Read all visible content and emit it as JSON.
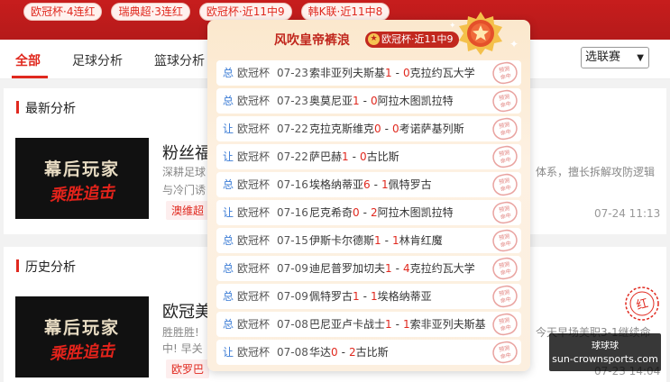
{
  "top_tags": [
    "欧冠杯·4连红",
    "瑞典超·3连红",
    "欧冠杯·近11中9",
    "韩K联·近11中8"
  ],
  "tabs": [
    "全部",
    "足球分析",
    "篮球分析"
  ],
  "league_select": {
    "value": "选联赛"
  },
  "sections": {
    "latest": {
      "title": "最新分析",
      "thumb_line1": "幕后玩家",
      "thumb_line2": "乘胜追击",
      "article_title": "粉丝福",
      "desc_line1": "深耕足球",
      "desc_line1_right": "体系，擅长拆解攻防逻辑",
      "desc_line2": "与冷门诱",
      "league": "澳维超",
      "time": "07-24 11:13"
    },
    "history": {
      "title": "历史分析",
      "thumb_line1": "幕后玩家",
      "thumb_line2": "乘胜追击",
      "article_title": "欧冠美",
      "desc_line1": "胜胜胜!",
      "desc_line1_right": "今天早场美职3-1继续命",
      "desc_line2": "中! 早关",
      "league": "欧罗巴",
      "time": "07-23 14:04"
    }
  },
  "popup": {
    "title": "风吹皇帝裤浪",
    "badge": "欧冠杯·近11中9",
    "stamp_text": "预测命中",
    "matches": [
      {
        "type": "总",
        "league": "欧冠杯",
        "date": "07-23",
        "home": "索非亚列夫斯基",
        "home_score": "1",
        "away_score": "0",
        "away": "克拉约瓦大学"
      },
      {
        "type": "总",
        "league": "欧冠杯",
        "date": "07-23",
        "home": "奥莫尼亚",
        "home_score": "1",
        "away_score": "0",
        "away": "阿拉木图凯拉特"
      },
      {
        "type": "让",
        "league": "欧冠杯",
        "date": "07-22",
        "home": "克拉克斯维克",
        "home_score": "0",
        "away_score": "0",
        "away": "考诺萨基列斯"
      },
      {
        "type": "让",
        "league": "欧冠杯",
        "date": "07-22",
        "home": "萨巴赫",
        "home_score": "1",
        "away_score": "0",
        "away": "古比斯"
      },
      {
        "type": "总",
        "league": "欧冠杯",
        "date": "07-16",
        "home": "埃格纳蒂亚",
        "home_score": "6",
        "away_score": "1",
        "away": "佩特罗古"
      },
      {
        "type": "让",
        "league": "欧冠杯",
        "date": "07-16",
        "home": "尼克希奇",
        "home_score": "0",
        "away_score": "2",
        "away": "阿拉木图凯拉特"
      },
      {
        "type": "总",
        "league": "欧冠杯",
        "date": "07-15",
        "home": "伊斯卡尔德斯",
        "home_score": "1",
        "away_score": "1",
        "away": "林肯红魔"
      },
      {
        "type": "总",
        "league": "欧冠杯",
        "date": "07-09",
        "home": "迪尼普罗加切夫",
        "home_score": "1",
        "away_score": "4",
        "away": "克拉约瓦大学"
      },
      {
        "type": "总",
        "league": "欧冠杯",
        "date": "07-09",
        "home": "佩特罗古",
        "home_score": "1",
        "away_score": "1",
        "away": "埃格纳蒂亚"
      },
      {
        "type": "总",
        "league": "欧冠杯",
        "date": "07-08",
        "home": "巴尼亚卢卡战士",
        "home_score": "1",
        "away_score": "1",
        "away": "索非亚列夫斯基"
      },
      {
        "type": "让",
        "league": "欧冠杯",
        "date": "07-08",
        "home": "华达",
        "home_score": "0",
        "away_score": "2",
        "away": "古比斯"
      }
    ]
  },
  "float_box": {
    "line1": "球球球",
    "line2": "sun-crownsports.com"
  },
  "colors": {
    "brand_red": "#e0291f",
    "band_red": "#c71d1d",
    "popup_bg": "#fbe8cd"
  }
}
